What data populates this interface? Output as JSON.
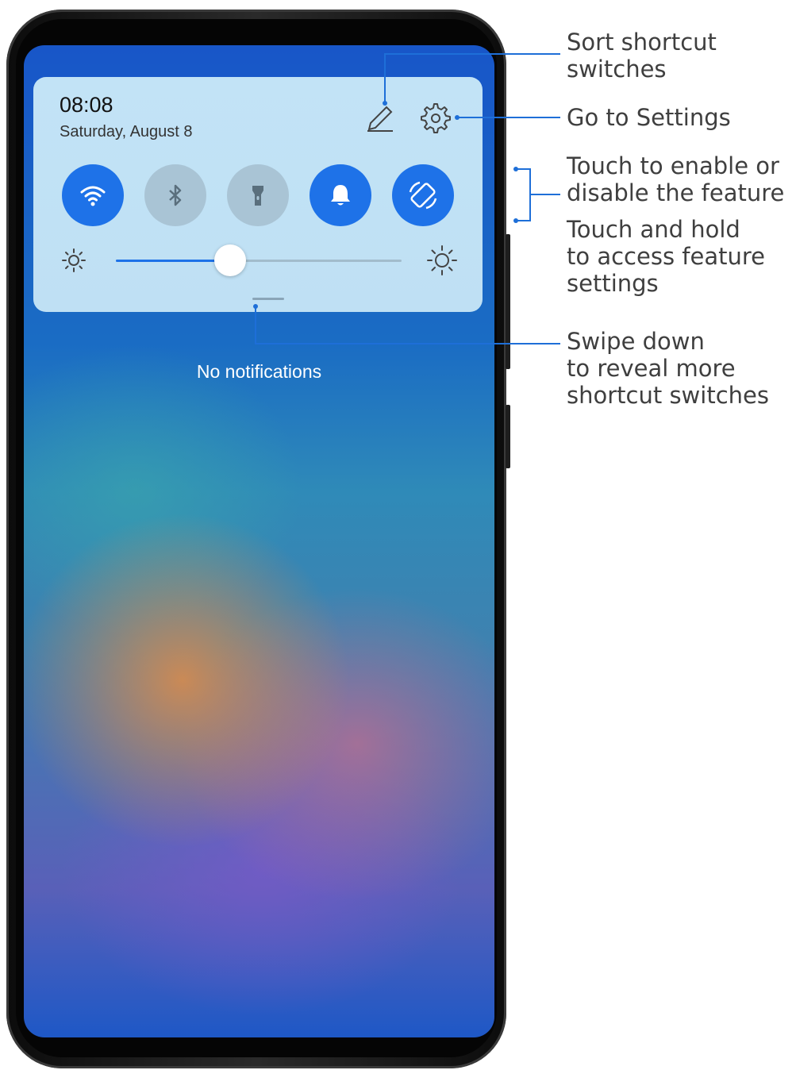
{
  "status": {
    "time": "08:08",
    "date": "Saturday, August 8"
  },
  "panel": {
    "toggles": [
      {
        "name": "wifi",
        "icon": "wifi-icon",
        "state": "on"
      },
      {
        "name": "bluetooth",
        "icon": "bluetooth-icon",
        "state": "off"
      },
      {
        "name": "flashlight",
        "icon": "flashlight-icon",
        "state": "off"
      },
      {
        "name": "sound",
        "icon": "bell-icon",
        "state": "on"
      },
      {
        "name": "auto-rotate",
        "icon": "rotate-icon",
        "state": "on"
      }
    ],
    "brightness_fraction": 0.4,
    "accent_color": "#1e72e8"
  },
  "notifications": {
    "empty_text": "No notifications"
  },
  "callouts": {
    "sort_switches": "Sort shortcut\nswitches",
    "go_to_settings": "Go to Settings",
    "touch_enable": "Touch to enable or\ndisable the feature",
    "touch_hold": "Touch and hold\nto access feature\nsettings",
    "swipe_down": "Swipe down\nto reveal more\nshortcut switches",
    "line_color": "#1e6fd8"
  }
}
